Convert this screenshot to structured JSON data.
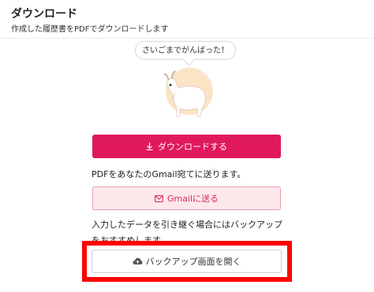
{
  "header": {
    "title": "ダウンロード",
    "subtitle": "作成した履歴書をPDFでダウンロードします"
  },
  "mascot": {
    "speech": "さいごまでがんばった！",
    "icon": "goat-mascot"
  },
  "download_button": {
    "label": "ダウンロードする",
    "icon": "download-icon"
  },
  "gmail": {
    "description": "PDFをあなたのGmail宛てに送ります。",
    "button_label": "Gmailに送る",
    "icon": "mail-icon"
  },
  "backup": {
    "description_line1": "入力したデータを引き継ぐ場合にはバックアップ",
    "description_line2": "をおすすめします",
    "button_label": "バックアップ画面を開く",
    "icon": "cloud-upload-icon"
  },
  "colors": {
    "accent": "#e0195f",
    "gmail_bg": "#fde9ec",
    "gmail_border": "#e99bb2",
    "highlight": "#ff0000"
  }
}
